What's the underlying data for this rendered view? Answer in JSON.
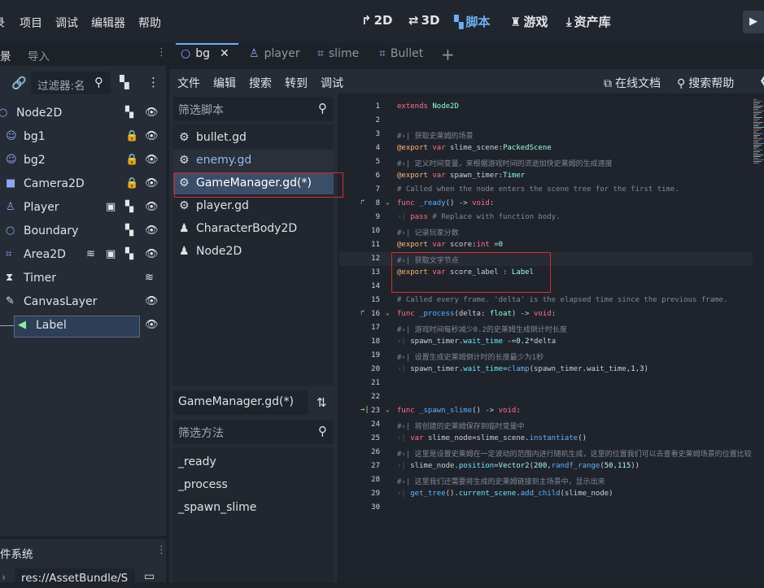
{
  "menu": [
    "录",
    "项目",
    "调试",
    "编辑器",
    "帮助"
  ],
  "workspaces": [
    {
      "label": "2D",
      "icon": "2d-icon",
      "glyph": "↱"
    },
    {
      "label": "3D",
      "icon": "3d-icon",
      "glyph": "⇄"
    },
    {
      "label": "脚本",
      "icon": "script-icon",
      "glyph": "▚"
    },
    {
      "label": "游戏",
      "icon": "game-icon",
      "glyph": "♜"
    },
    {
      "label": "资产库",
      "icon": "asset-library-icon",
      "glyph": "⤓"
    }
  ],
  "scene_dock": {
    "tabs": [
      "景",
      "导入"
    ],
    "filter_placeholder": "过滤器:名",
    "tree": [
      {
        "label": "Node2D",
        "icon": "node2d-icon",
        "glyph": "○",
        "color": "#8da5f3",
        "indent": 0
      },
      {
        "label": "bg1",
        "icon": "sprite-icon",
        "glyph": "☺",
        "color": "#8da5f3",
        "indent": 1
      },
      {
        "label": "bg2",
        "icon": "sprite-icon",
        "glyph": "☺",
        "color": "#8da5f3",
        "indent": 1
      },
      {
        "label": "Camera2D",
        "icon": "camera-icon",
        "glyph": "■",
        "color": "#8da5f3",
        "indent": 1
      },
      {
        "label": "Player",
        "icon": "character-icon",
        "glyph": "♙",
        "color": "#8da5f3",
        "indent": 1
      },
      {
        "label": "Boundary",
        "icon": "node2d-icon",
        "glyph": "○",
        "color": "#8da5f3",
        "indent": 1
      },
      {
        "label": "Area2D",
        "icon": "area2d-icon",
        "glyph": "⌗",
        "color": "#8da5f3",
        "indent": 1
      },
      {
        "label": "Timer",
        "icon": "timer-icon",
        "glyph": "⧗",
        "color": "#e0e0e0",
        "indent": 1
      },
      {
        "label": "CanvasLayer",
        "icon": "canvaslayer-icon",
        "glyph": "✎",
        "color": "#e0e0e0",
        "indent": 1
      },
      {
        "label": "Label",
        "icon": "label-icon",
        "glyph": "◀",
        "color": "#8eef97",
        "indent": 2
      }
    ]
  },
  "fs_dock": {
    "tab": "件系统",
    "path": "res://AssetBundle/S"
  },
  "editor_tabs": [
    {
      "label": "bg",
      "icon": "node2d-icon",
      "glyph": "○",
      "active": true
    },
    {
      "label": "player",
      "icon": "character-icon",
      "glyph": "♙",
      "active": false
    },
    {
      "label": "slime",
      "icon": "area2d-icon",
      "glyph": "⌗",
      "active": false
    },
    {
      "label": "Bullet",
      "icon": "area2d-icon",
      "glyph": "⌗",
      "active": false
    }
  ],
  "editor_menu": [
    "文件",
    "编辑",
    "搜索",
    "转到",
    "调试"
  ],
  "editor_menu_right": [
    {
      "label": "在线文档",
      "icon": "external-link-icon",
      "glyph": "⧉"
    },
    {
      "label": "搜索帮助",
      "icon": "help-search-icon",
      "glyph": "⚲"
    }
  ],
  "script_filter_placeholder": "筛选脚本",
  "scripts": [
    {
      "name": "bullet.gd",
      "icon": "gear-icon",
      "glyph": "⚙",
      "color": "#dfe1e4"
    },
    {
      "name": "enemy.gd",
      "icon": "gear-icon",
      "glyph": "⚙",
      "color": "#8fb8ef"
    },
    {
      "name": "GameManager.gd(*)",
      "icon": "gear-icon",
      "glyph": "⚙",
      "color": "#ffffff"
    },
    {
      "name": "player.gd",
      "icon": "gear-icon",
      "glyph": "⚙",
      "color": "#dfe1e4"
    },
    {
      "name": "CharacterBody2D",
      "icon": "doc-icon",
      "glyph": "♟",
      "color": "#dfe1e4"
    },
    {
      "name": "Node2D",
      "icon": "doc-icon",
      "glyph": "♟",
      "color": "#dfe1e4"
    }
  ],
  "current_script": "GameManager.gd(*)",
  "method_filter_placeholder": "筛选方法",
  "methods": [
    "_ready",
    "_process",
    "_spawn_slime"
  ],
  "code": [
    {
      "n": 1,
      "t": [
        [
          "kw",
          "extends "
        ],
        [
          "ty",
          "Node2D"
        ]
      ]
    },
    {
      "n": 2,
      "t": []
    },
    {
      "n": 3,
      "t": [
        [
          "cm",
          "#›| 获取史莱姆的场景"
        ]
      ]
    },
    {
      "n": 4,
      "t": [
        [
          "anno",
          "@export "
        ],
        [
          "kw",
          "var "
        ],
        [
          "tx",
          "slime_scene:"
        ],
        [
          "ty",
          "PackedScene"
        ]
      ]
    },
    {
      "n": 5,
      "t": [
        [
          "cm",
          "#›| 定义时间变量，来根据游戏时间的流逝加快史莱姆的生成速度"
        ]
      ]
    },
    {
      "n": 6,
      "t": [
        [
          "anno",
          "@export "
        ],
        [
          "kw",
          "var "
        ],
        [
          "tx",
          "spawn_timer:"
        ],
        [
          "ty",
          "Timer"
        ]
      ]
    },
    {
      "n": 7,
      "t": [
        [
          "cm",
          "# Called when the node enters the scene tree for the first time."
        ]
      ]
    },
    {
      "n": 8,
      "gut": "↱",
      "fold": true,
      "t": [
        [
          "kw",
          "func "
        ],
        [
          "fn",
          "_ready"
        ],
        [
          "tx",
          "() -> "
        ],
        [
          "kw",
          "void"
        ],
        [
          "tx",
          ":"
        ]
      ]
    },
    {
      "n": 9,
      "t": [
        [
          "tabarr",
          "›| "
        ],
        [
          "kw",
          "pass "
        ],
        [
          "cm",
          "# Replace with function body."
        ]
      ]
    },
    {
      "n": 10,
      "t": [
        [
          "cm",
          "#›| 记录玩家分数"
        ]
      ]
    },
    {
      "n": 11,
      "t": [
        [
          "anno",
          "@export "
        ],
        [
          "kw",
          "var "
        ],
        [
          "tx",
          "score:"
        ],
        [
          "kw",
          "int "
        ],
        [
          "tx",
          "="
        ],
        [
          "num",
          "0"
        ]
      ]
    },
    {
      "n": 12,
      "hl": true,
      "t": [
        [
          "cm",
          "#›| 获取文字节点"
        ]
      ]
    },
    {
      "n": 13,
      "t": [
        [
          "anno",
          "@export "
        ],
        [
          "kw",
          "var "
        ],
        [
          "tx",
          "score_label : "
        ],
        [
          "ty",
          "Label"
        ]
      ]
    },
    {
      "n": 14,
      "t": []
    },
    {
      "n": 15,
      "t": [
        [
          "cm",
          "# Called every frame. 'delta' is the elapsed time since the previous frame."
        ]
      ]
    },
    {
      "n": 16,
      "gut": "↱",
      "fold": true,
      "t": [
        [
          "kw",
          "func "
        ],
        [
          "fn",
          "_process"
        ],
        [
          "tx",
          "(delta: "
        ],
        [
          "ty",
          "float"
        ],
        [
          "tx",
          ") -> "
        ],
        [
          "kw",
          "void"
        ],
        [
          "tx",
          ":"
        ]
      ]
    },
    {
      "n": 17,
      "t": [
        [
          "cm",
          "#›| 游戏时间每秒减少0.2的史莱姆生成倒计时长度"
        ]
      ]
    },
    {
      "n": 18,
      "t": [
        [
          "tabarr",
          "›| "
        ],
        [
          "tx",
          "spawn_timer."
        ],
        [
          "fn2",
          "wait_time"
        ],
        [
          "tx",
          " -="
        ],
        [
          "num",
          "0.2"
        ],
        [
          "tx",
          "*delta"
        ]
      ]
    },
    {
      "n": 19,
      "t": [
        [
          "cm",
          "#›| 设置生成史莱姆倒计时的长度最少为1秒"
        ]
      ]
    },
    {
      "n": 20,
      "t": [
        [
          "tabarr",
          "›| "
        ],
        [
          "tx",
          "spawn_timer."
        ],
        [
          "fn2",
          "wait_time"
        ],
        [
          "tx",
          "="
        ],
        [
          "fn",
          "clamp"
        ],
        [
          "tx",
          "(spawn_timer.wait_time,"
        ],
        [
          "num",
          "1"
        ],
        [
          "tx",
          ","
        ],
        [
          "num",
          "3"
        ],
        [
          "tx",
          ")"
        ]
      ]
    },
    {
      "n": 21,
      "t": []
    },
    {
      "n": 22,
      "t": []
    },
    {
      "n": 23,
      "gut": "→|",
      "fold": true,
      "t": [
        [
          "kw",
          "func "
        ],
        [
          "fn",
          "_spawn_slime"
        ],
        [
          "tx",
          "() -> "
        ],
        [
          "kw",
          "void"
        ],
        [
          "tx",
          ":"
        ]
      ]
    },
    {
      "n": 24,
      "t": [
        [
          "cm",
          "#›| 将创建的史莱姆保存到临时变量中"
        ]
      ]
    },
    {
      "n": 25,
      "t": [
        [
          "tabarr",
          "›| "
        ],
        [
          "kw",
          "var "
        ],
        [
          "tx",
          "slime_node=slime_scene."
        ],
        [
          "fn",
          "instantiate"
        ],
        [
          "tx",
          "()"
        ]
      ]
    },
    {
      "n": 26,
      "t": [
        [
          "cm",
          "#›| 这里是设置史莱姆在一定波动的范围内进行随机生成，这里的位置我们可以去查看史莱姆场景的位置比较"
        ]
      ]
    },
    {
      "n": 27,
      "t": [
        [
          "tabarr",
          "›| "
        ],
        [
          "tx",
          "slime_node."
        ],
        [
          "fn2",
          "position"
        ],
        [
          "tx",
          "="
        ],
        [
          "ty",
          "Vector2"
        ],
        [
          "tx",
          "("
        ],
        [
          "num",
          "200"
        ],
        [
          "tx",
          ","
        ],
        [
          "fn",
          "randf_range"
        ],
        [
          "tx",
          "("
        ],
        [
          "num",
          "50"
        ],
        [
          "tx",
          ","
        ],
        [
          "num",
          "115"
        ],
        [
          "tx",
          "))"
        ]
      ]
    },
    {
      "n": 28,
      "t": [
        [
          "cm",
          "#›| 这里我们还需要将生成的史莱姆链接到主场景中，显示出来"
        ]
      ]
    },
    {
      "n": 29,
      "t": [
        [
          "tabarr",
          "›| "
        ],
        [
          "fn",
          "get_tree"
        ],
        [
          "tx",
          "()."
        ],
        [
          "fn2",
          "current_scene"
        ],
        [
          "tx",
          "."
        ],
        [
          "fn",
          "add_child"
        ],
        [
          "tx",
          "(slime_node)"
        ]
      ]
    },
    {
      "n": 30,
      "t": []
    }
  ],
  "colors": {
    "accent": "#6ab0f3",
    "highlight_box": "#e0262c"
  }
}
